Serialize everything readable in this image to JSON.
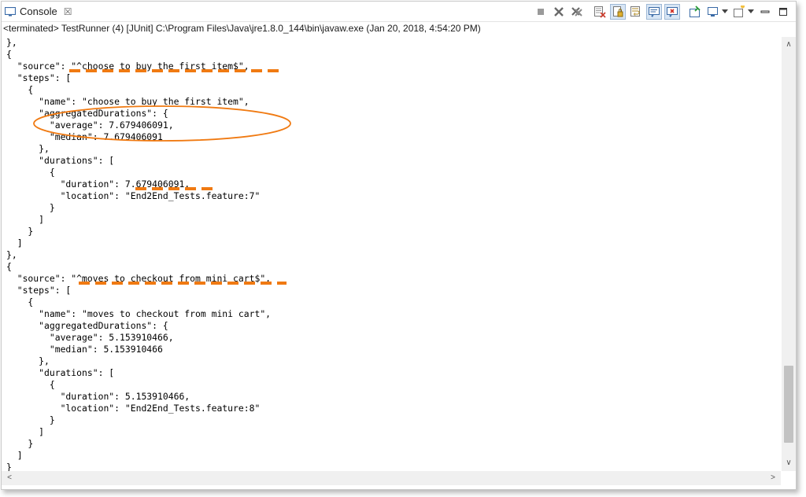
{
  "tab": {
    "label": "Console",
    "close_glyph": "☒"
  },
  "toolbar": {
    "icons": [
      "terminate-icon",
      "remove-launch-icon",
      "remove-all-terminated-icon",
      "clear-console-icon",
      "scroll-lock-icon",
      "word-wrap-icon",
      "show-on-stdout-icon",
      "show-on-stderr-icon",
      "pin-console-icon",
      "display-console-icon",
      "open-console-icon",
      "minimize-icon",
      "maximize-icon"
    ]
  },
  "status_line": "<terminated> TestRunner (4) [JUnit] C:\\Program Files\\Java\\jre1.8.0_144\\bin\\javaw.exe (Jan 20, 2018, 4:54:20 PM)",
  "console_lines": [
    "},",
    "{",
    "  \"source\": \"^choose to buy the first item$\",",
    "  \"steps\": [",
    "    {",
    "      \"name\": \"choose to buy the first item\",",
    "      \"aggregatedDurations\": {",
    "        \"average\": 7.679406091,",
    "        \"median\": 7.679406091",
    "      },",
    "      \"durations\": [",
    "        {",
    "          \"duration\": 7.679406091,",
    "          \"location\": \"End2End_Tests.feature:7\"",
    "        }",
    "      ]",
    "    }",
    "  ]",
    "},",
    "{",
    "  \"source\": \"^moves to checkout from mini cart$\",",
    "  \"steps\": [",
    "    {",
    "      \"name\": \"moves to checkout from mini cart\",",
    "      \"aggregatedDurations\": {",
    "        \"average\": 5.153910466,",
    "        \"median\": 5.153910466",
    "      },",
    "      \"durations\": [",
    "        {",
    "          \"duration\": 5.153910466,",
    "          \"location\": \"End2End_Tests.feature:8\"",
    "        }",
    "      ]",
    "    }",
    "  ]",
    "}"
  ],
  "scrollbar": {
    "up_glyph": "∧",
    "down_glyph": "∨",
    "left_glyph": "<",
    "right_glyph": ">"
  },
  "colors": {
    "annotation": "#f07a12",
    "toolbar_pressed": "#d8e6f5",
    "scroll_thumb": "#c2c2c2"
  }
}
